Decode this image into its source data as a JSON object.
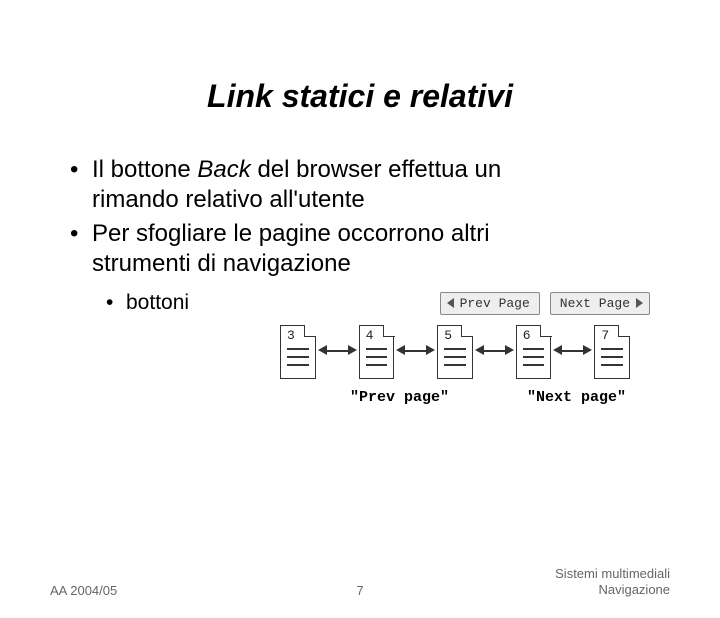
{
  "title": "Link statici e relativi",
  "bullets": {
    "b1": {
      "pre": "Il bottone ",
      "em": "Back",
      "post": " del browser effettua un",
      "line2": "rimando relativo all'utente"
    },
    "b2": {
      "line1": "Per sfogliare le pagine occorrono altri",
      "line2": "strumenti di navigazione"
    },
    "b3": "bottoni"
  },
  "navButtons": {
    "prev": "Prev Page",
    "next": "Next Page"
  },
  "diagram": {
    "pages": [
      "3",
      "4",
      "5",
      "6",
      "7"
    ],
    "captions": {
      "prev": "\"Prev page\"",
      "next": "\"Next page\""
    }
  },
  "footer": {
    "left": "AA 2004/05",
    "center": "7",
    "right1": "Sistemi multimediali",
    "right2": "Navigazione"
  }
}
